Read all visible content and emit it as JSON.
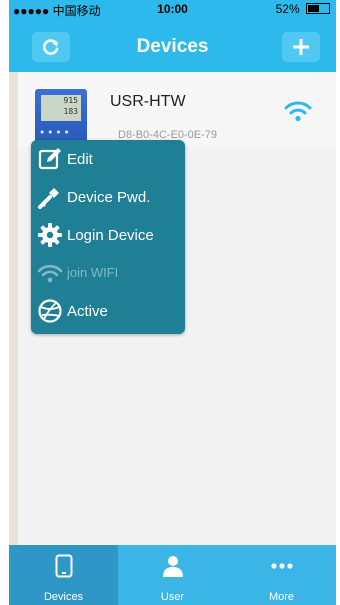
{
  "status_bar": {
    "carrier": "●●●●● 中国移动",
    "time": "10:00",
    "battery": "52%"
  },
  "header": {
    "title": "Devices"
  },
  "device": {
    "name": "USR-HTW",
    "mac": "D8-B0-4C-E0-0E-79",
    "display_line1": "915",
    "display_line2": "183"
  },
  "menu": {
    "items": [
      {
        "label": "Edit",
        "icon": "edit-icon",
        "enabled": true
      },
      {
        "label": "Device Pwd.",
        "icon": "key-icon",
        "enabled": true
      },
      {
        "label": "Login Device",
        "icon": "gear-icon",
        "enabled": true
      },
      {
        "label": "join WIFI",
        "icon": "wifi-icon",
        "enabled": false
      },
      {
        "label": "Active",
        "icon": "globe-icon",
        "enabled": true
      }
    ]
  },
  "tabs": [
    {
      "label": "Devices",
      "icon": "phone-icon",
      "active": true
    },
    {
      "label": "User",
      "icon": "user-icon",
      "active": false
    },
    {
      "label": "More",
      "icon": "more-icon",
      "active": false
    }
  ],
  "colors": {
    "accent": "#2db9eb",
    "menu_bg": "#1f7f95",
    "tab_active": "#2e97c8"
  }
}
